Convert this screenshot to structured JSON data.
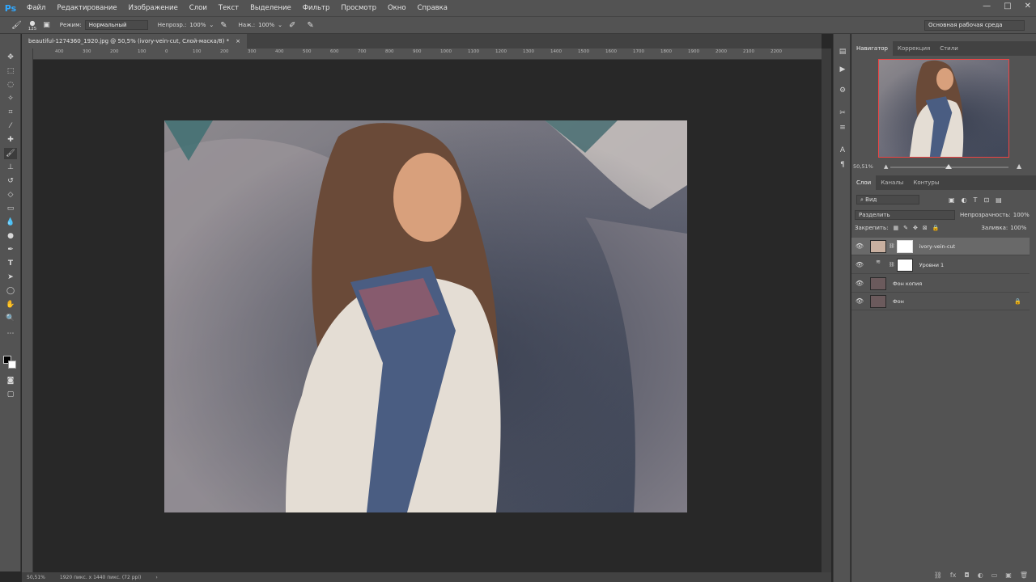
{
  "app": {
    "logo": "Ps"
  },
  "menu": [
    "Файл",
    "Редактирование",
    "Изображение",
    "Слои",
    "Текст",
    "Выделение",
    "Фильтр",
    "Просмотр",
    "Окно",
    "Справка"
  ],
  "window_controls": {
    "minimize": "—",
    "maximize": "□",
    "close": "✕"
  },
  "options": {
    "brush_size": "125",
    "mode_label": "Режим:",
    "mode_value": "Нормальный",
    "opacity_label": "Непрозр.:",
    "opacity_value": "100%",
    "flow_label": "Наж.:",
    "flow_value": "100%",
    "workspace": "Основная рабочая среда"
  },
  "document": {
    "tab_title": "beautiful-1274360_1920.jpg @ 50,5% (ivory-vein-cut, Слой-маска/8) *",
    "tab_close": "×",
    "zoom": "50,51%",
    "doc_info": "1920 пикс. x 1440 пикс. (72 ppi)",
    "status_arrow": "›"
  },
  "ruler_marks": [
    "400",
    "300",
    "200",
    "100",
    "0",
    "100",
    "200",
    "300",
    "400",
    "500",
    "600",
    "700",
    "800",
    "900",
    "1000",
    "1100",
    "1200",
    "1300",
    "1400",
    "1500",
    "1600",
    "1700",
    "1800",
    "1900",
    "2000",
    "2100",
    "2200"
  ],
  "navigator": {
    "tabs": [
      "Навигатор",
      "Коррекция",
      "Стили"
    ],
    "zoom": "50,51%"
  },
  "layers_panel": {
    "tabs": [
      "Слои",
      "Каналы",
      "Контуры"
    ],
    "filter_label": "Вид",
    "blend_mode": "Разделить",
    "opacity_label": "Непрозрачность:",
    "opacity_value": "100%",
    "lock_label": "Закрепить:",
    "fill_label": "Заливка:",
    "fill_value": "100%",
    "layers": [
      {
        "name": "ivory-vein-cut",
        "selected": true
      },
      {
        "name": "Уровни 1",
        "selected": false
      },
      {
        "name": "Фон копия",
        "selected": false
      },
      {
        "name": "Фон",
        "selected": false,
        "locked": true
      }
    ]
  },
  "colors": {
    "nav_frame": "#e44444",
    "logo": "#31a8ff",
    "panel": "#535353",
    "canvas": "#282828"
  }
}
